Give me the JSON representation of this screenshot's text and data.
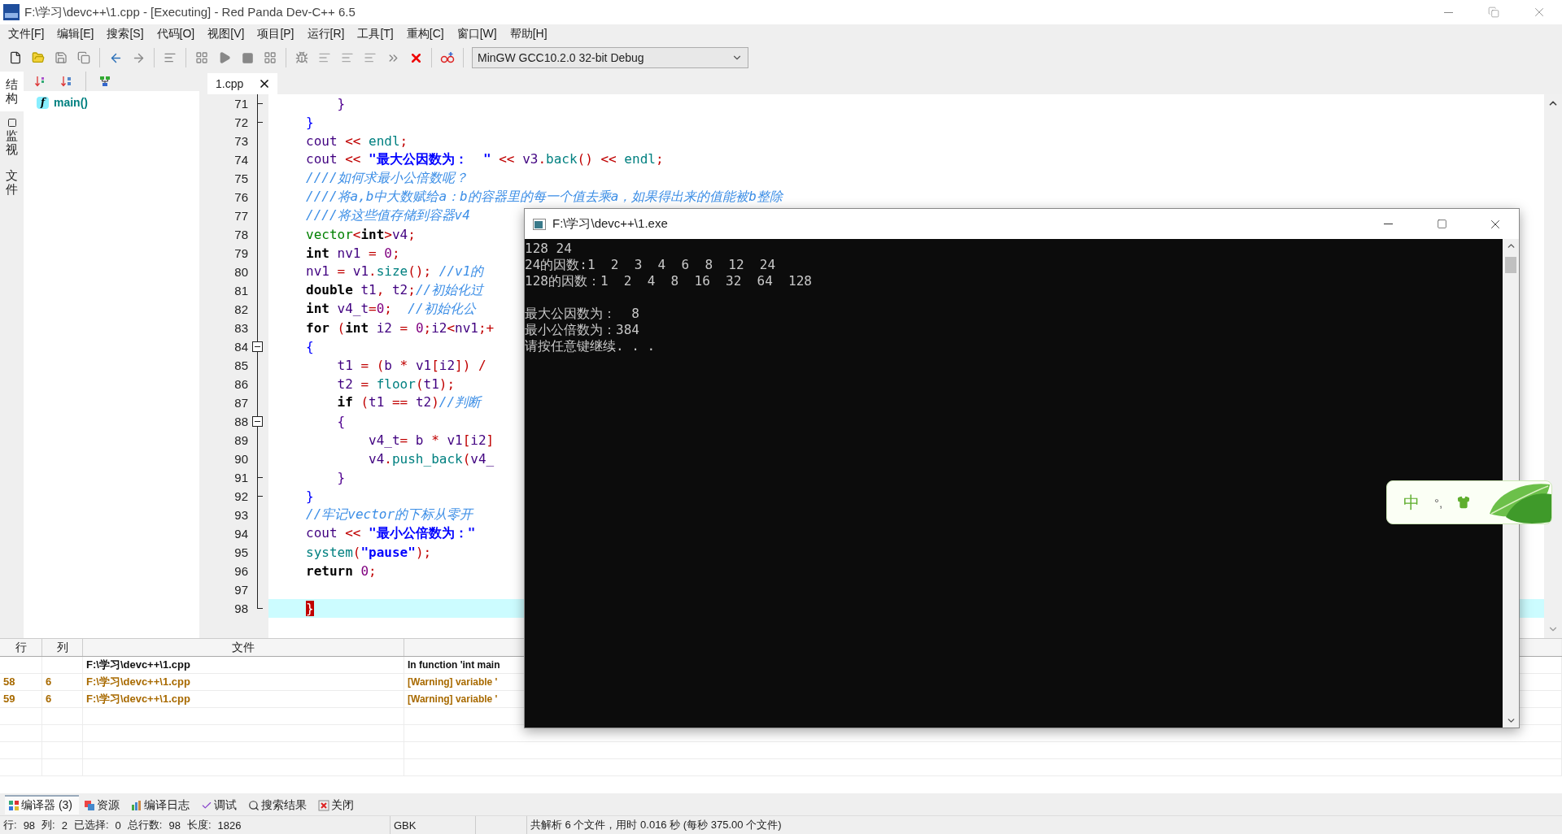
{
  "window": {
    "title": "F:\\学习\\devc++\\1.cpp - [Executing] - Red Panda Dev-C++ 6.5"
  },
  "menu": [
    "文件[F]",
    "编辑[E]",
    "搜索[S]",
    "代码[O]",
    "视图[V]",
    "项目[P]",
    "运行[R]",
    "工具[T]",
    "重构[C]",
    "窗口[W]",
    "帮助[H]"
  ],
  "compiler_select": {
    "value": "MinGW GCC10.2.0 32-bit Debug"
  },
  "side_tabs": [
    {
      "label": "结构",
      "selected": true
    },
    {
      "label": "监视",
      "selected": false
    },
    {
      "label": "文件",
      "selected": false
    }
  ],
  "structure": {
    "items": [
      {
        "icon": "f",
        "label": "main()"
      }
    ]
  },
  "editor": {
    "tabs": [
      {
        "label": "1.cpp",
        "selected": true
      }
    ],
    "lines": [
      {
        "n": "71",
        "kind": "end",
        "current": false,
        "t": [
          {
            "kind": "b2",
            "text": "    }"
          }
        ]
      },
      {
        "n": "72",
        "kind": "end",
        "current": false,
        "t": [
          {
            "kind": "b1",
            "text": "}"
          }
        ]
      },
      {
        "n": "73",
        "kind": "plain",
        "current": false,
        "t": [
          {
            "kind": "id",
            "text": "cout"
          },
          {
            "kind": "op",
            "text": " << "
          },
          {
            "kind": "fn",
            "text": "endl"
          },
          {
            "kind": "op",
            "text": ";"
          }
        ]
      },
      {
        "n": "74",
        "kind": "plain",
        "current": false,
        "t": [
          {
            "kind": "id",
            "text": "cout"
          },
          {
            "kind": "op",
            "text": " << "
          },
          {
            "kind": "str",
            "text": "\"最大公因数为：  \""
          },
          {
            "kind": "op",
            "text": " << "
          },
          {
            "kind": "id",
            "text": "v3"
          },
          {
            "kind": "op",
            "text": "."
          },
          {
            "kind": "fn",
            "text": "back"
          },
          {
            "kind": "op",
            "text": "()"
          },
          {
            "kind": "op",
            "text": " << "
          },
          {
            "kind": "fn",
            "text": "endl"
          },
          {
            "kind": "op",
            "text": ";"
          }
        ]
      },
      {
        "n": "75",
        "kind": "plain",
        "current": false,
        "t": [
          {
            "kind": "cmt",
            "text": "////如何求最小公倍数呢？"
          }
        ]
      },
      {
        "n": "76",
        "kind": "plain",
        "current": false,
        "t": [
          {
            "kind": "cmt",
            "text": "////将a,b中大数赋给a：b的容器里的每一个值去乘a，如果得出来的值能被b整除"
          }
        ]
      },
      {
        "n": "77",
        "kind": "plain",
        "current": false,
        "t": [
          {
            "kind": "cmt",
            "text": "////将这些值存储到容器v4"
          }
        ]
      },
      {
        "n": "78",
        "kind": "plain",
        "current": false,
        "t": [
          {
            "kind": "ty",
            "text": "vector"
          },
          {
            "kind": "op",
            "text": "<"
          },
          {
            "kind": "kw",
            "text": "int"
          },
          {
            "kind": "op",
            "text": ">"
          },
          {
            "kind": "id",
            "text": "v4"
          },
          {
            "kind": "op",
            "text": ";"
          }
        ]
      },
      {
        "n": "79",
        "kind": "plain",
        "current": false,
        "t": [
          {
            "kind": "kw",
            "text": "int"
          },
          {
            "kind": "id",
            "text": " nv1 "
          },
          {
            "kind": "op",
            "text": "= "
          },
          {
            "kind": "num",
            "text": "0"
          },
          {
            "kind": "op",
            "text": ";"
          }
        ]
      },
      {
        "n": "80",
        "kind": "plain",
        "current": false,
        "t": [
          {
            "kind": "id",
            "text": "nv1 "
          },
          {
            "kind": "op",
            "text": "= "
          },
          {
            "kind": "id",
            "text": "v1"
          },
          {
            "kind": "op",
            "text": "."
          },
          {
            "kind": "fn",
            "text": "size"
          },
          {
            "kind": "op",
            "text": "();"
          },
          {
            "kind": "cmt",
            "text": " //v1的"
          }
        ]
      },
      {
        "n": "81",
        "kind": "plain",
        "current": false,
        "t": [
          {
            "kind": "kw",
            "text": "double"
          },
          {
            "kind": "id",
            "text": " t1"
          },
          {
            "kind": "op",
            "text": ","
          },
          {
            "kind": "id",
            "text": " t2"
          },
          {
            "kind": "op",
            "text": ";"
          },
          {
            "kind": "cmt",
            "text": "//初始化过"
          }
        ]
      },
      {
        "n": "82",
        "kind": "plain",
        "current": false,
        "t": [
          {
            "kind": "kw",
            "text": "int"
          },
          {
            "kind": "id",
            "text": " v4_t"
          },
          {
            "kind": "op",
            "text": "="
          },
          {
            "kind": "num",
            "text": "0"
          },
          {
            "kind": "op",
            "text": ";"
          },
          {
            "kind": "cmt",
            "text": "  //初始化公"
          }
        ]
      },
      {
        "n": "83",
        "kind": "plain",
        "current": false,
        "t": [
          {
            "kind": "kw",
            "text": "for"
          },
          {
            "kind": "op",
            "text": " ("
          },
          {
            "kind": "kw",
            "text": "int"
          },
          {
            "kind": "id",
            "text": " i2 "
          },
          {
            "kind": "op",
            "text": "= "
          },
          {
            "kind": "num",
            "text": "0"
          },
          {
            "kind": "op",
            "text": ";"
          },
          {
            "kind": "id",
            "text": "i2"
          },
          {
            "kind": "op",
            "text": "<"
          },
          {
            "kind": "id",
            "text": "nv1"
          },
          {
            "kind": "op",
            "text": ";+"
          }
        ]
      },
      {
        "n": "84",
        "kind": "start",
        "current": false,
        "t": [
          {
            "kind": "b1",
            "text": "{"
          }
        ]
      },
      {
        "n": "85",
        "kind": "plain",
        "current": false,
        "t": [
          {
            "kind": "id",
            "text": "    t1 "
          },
          {
            "kind": "op",
            "text": "= ("
          },
          {
            "kind": "id",
            "text": "b "
          },
          {
            "kind": "op",
            "text": "* "
          },
          {
            "kind": "id",
            "text": "v1"
          },
          {
            "kind": "op",
            "text": "["
          },
          {
            "kind": "id",
            "text": "i2"
          },
          {
            "kind": "op",
            "text": "]) /"
          }
        ]
      },
      {
        "n": "86",
        "kind": "plain",
        "current": false,
        "t": [
          {
            "kind": "id",
            "text": "    t2 "
          },
          {
            "kind": "op",
            "text": "= "
          },
          {
            "kind": "fn",
            "text": "floor"
          },
          {
            "kind": "op",
            "text": "("
          },
          {
            "kind": "id",
            "text": "t1"
          },
          {
            "kind": "op",
            "text": ");"
          }
        ]
      },
      {
        "n": "87",
        "kind": "plain",
        "current": false,
        "t": [
          {
            "kind": "kw",
            "text": "    if"
          },
          {
            "kind": "op",
            "text": " ("
          },
          {
            "kind": "id",
            "text": "t1 "
          },
          {
            "kind": "op",
            "text": "== "
          },
          {
            "kind": "id",
            "text": "t2"
          },
          {
            "kind": "op",
            "text": ")"
          },
          {
            "kind": "cmt",
            "text": "//判断"
          }
        ]
      },
      {
        "n": "88",
        "kind": "start",
        "current": false,
        "t": [
          {
            "kind": "b2",
            "text": "    {"
          }
        ]
      },
      {
        "n": "89",
        "kind": "plain",
        "current": false,
        "t": [
          {
            "kind": "id",
            "text": "        v4_t"
          },
          {
            "kind": "op",
            "text": "= "
          },
          {
            "kind": "id",
            "text": "b "
          },
          {
            "kind": "op",
            "text": "* "
          },
          {
            "kind": "id",
            "text": "v1"
          },
          {
            "kind": "op",
            "text": "["
          },
          {
            "kind": "id",
            "text": "i2"
          },
          {
            "kind": "op",
            "text": "]"
          }
        ]
      },
      {
        "n": "90",
        "kind": "plain",
        "current": false,
        "t": [
          {
            "kind": "id",
            "text": "        v4"
          },
          {
            "kind": "op",
            "text": "."
          },
          {
            "kind": "fn",
            "text": "push_back"
          },
          {
            "kind": "op",
            "text": "("
          },
          {
            "kind": "id",
            "text": "v4_"
          }
        ]
      },
      {
        "n": "91",
        "kind": "end",
        "current": false,
        "t": [
          {
            "kind": "b2",
            "text": "    }"
          }
        ]
      },
      {
        "n": "92",
        "kind": "end",
        "current": false,
        "t": [
          {
            "kind": "b1",
            "text": "}"
          }
        ]
      },
      {
        "n": "93",
        "kind": "plain",
        "current": false,
        "t": [
          {
            "kind": "cmt",
            "text": "//牢记vector的下标从零开"
          }
        ]
      },
      {
        "n": "94",
        "kind": "plain",
        "current": false,
        "t": [
          {
            "kind": "id",
            "text": "cout"
          },
          {
            "kind": "op",
            "text": " << "
          },
          {
            "kind": "str",
            "text": "\"最小公倍数为：\""
          }
        ]
      },
      {
        "n": "95",
        "kind": "plain",
        "current": false,
        "t": [
          {
            "kind": "fn",
            "text": "system"
          },
          {
            "kind": "op",
            "text": "("
          },
          {
            "kind": "str",
            "text": "\"pause\""
          },
          {
            "kind": "op",
            "text": ");"
          }
        ]
      },
      {
        "n": "96",
        "kind": "plain",
        "current": false,
        "t": [
          {
            "kind": "kw",
            "text": "return"
          },
          {
            "kind": "num",
            "text": " 0"
          },
          {
            "kind": "op",
            "text": ";"
          }
        ]
      },
      {
        "n": "97",
        "kind": "plain",
        "current": false
      },
      {
        "n": "98",
        "kind": "last",
        "current": true,
        "t": [
          {
            "kind": "match",
            "text": "}"
          }
        ]
      }
    ]
  },
  "messages": {
    "columns": [
      "行",
      "列",
      "文件"
    ],
    "rows": [
      {
        "kind": "header",
        "file": "F:\\学习\\devc++\\1.cpp",
        "message": "In function 'int main"
      },
      {
        "kind": "warning",
        "line": "58",
        "col": "6",
        "file": "F:\\学习\\devc++\\1.cpp",
        "message": "[Warning] variable '"
      },
      {
        "kind": "warning",
        "line": "59",
        "col": "6",
        "file": "F:\\学习\\devc++\\1.cpp",
        "message": "[Warning] variable '"
      }
    ]
  },
  "bottom_tabs": [
    {
      "label": "编译器 (3)",
      "selected": true
    },
    {
      "label": "资源",
      "selected": false
    },
    {
      "label": "编译日志",
      "selected": false
    },
    {
      "label": "调试",
      "selected": false
    },
    {
      "label": "搜索结果",
      "selected": false
    },
    {
      "label": "关闭",
      "selected": false
    }
  ],
  "status_bar": {
    "fields": [
      {
        "label": "行:",
        "value": "98"
      },
      {
        "label": "列:",
        "value": "2"
      },
      {
        "label": "已选择:",
        "value": "0"
      },
      {
        "label": "总行数:",
        "value": "98"
      },
      {
        "label": "长度:",
        "value": "1826"
      }
    ],
    "encoding": "GBK",
    "message": "共解析 6 个文件，用时 0.016 秒 (每秒 375.00 个文件)"
  },
  "console": {
    "title": "F:\\学习\\devc++\\1.exe",
    "blocks": [
      [
        "128 24",
        "24的因数:1  2  3  4  6  8  12  24",
        "128的因数：1  2  4  8  16  32  64  128"
      ],
      [
        "最大公因数为：  8",
        "最小公倍数为：384",
        "请按任意键继续. . ."
      ]
    ]
  },
  "ime": {
    "mode": "中",
    "punctuation": "°,"
  }
}
